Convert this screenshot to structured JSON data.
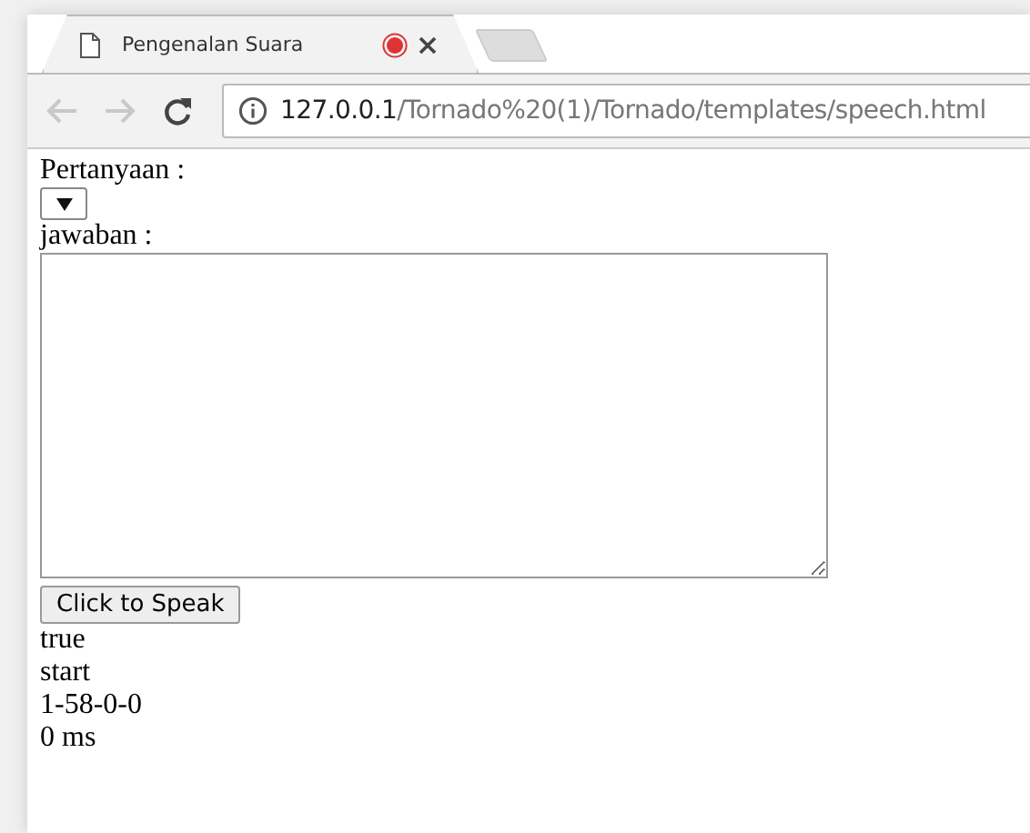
{
  "browser": {
    "tab": {
      "title": "Pengenalan Suara",
      "recording": true
    },
    "address": {
      "host": "127.0.0.1",
      "path": "/Tornado%20(1)/Tornado/templates/speech.html"
    }
  },
  "page": {
    "question_label": "Pertanyaan :",
    "answer_label": "jawaban :",
    "button": "Click to Speak",
    "output_lines": [
      "true",
      "start",
      "1-58-0-0",
      "0 ms"
    ]
  }
}
